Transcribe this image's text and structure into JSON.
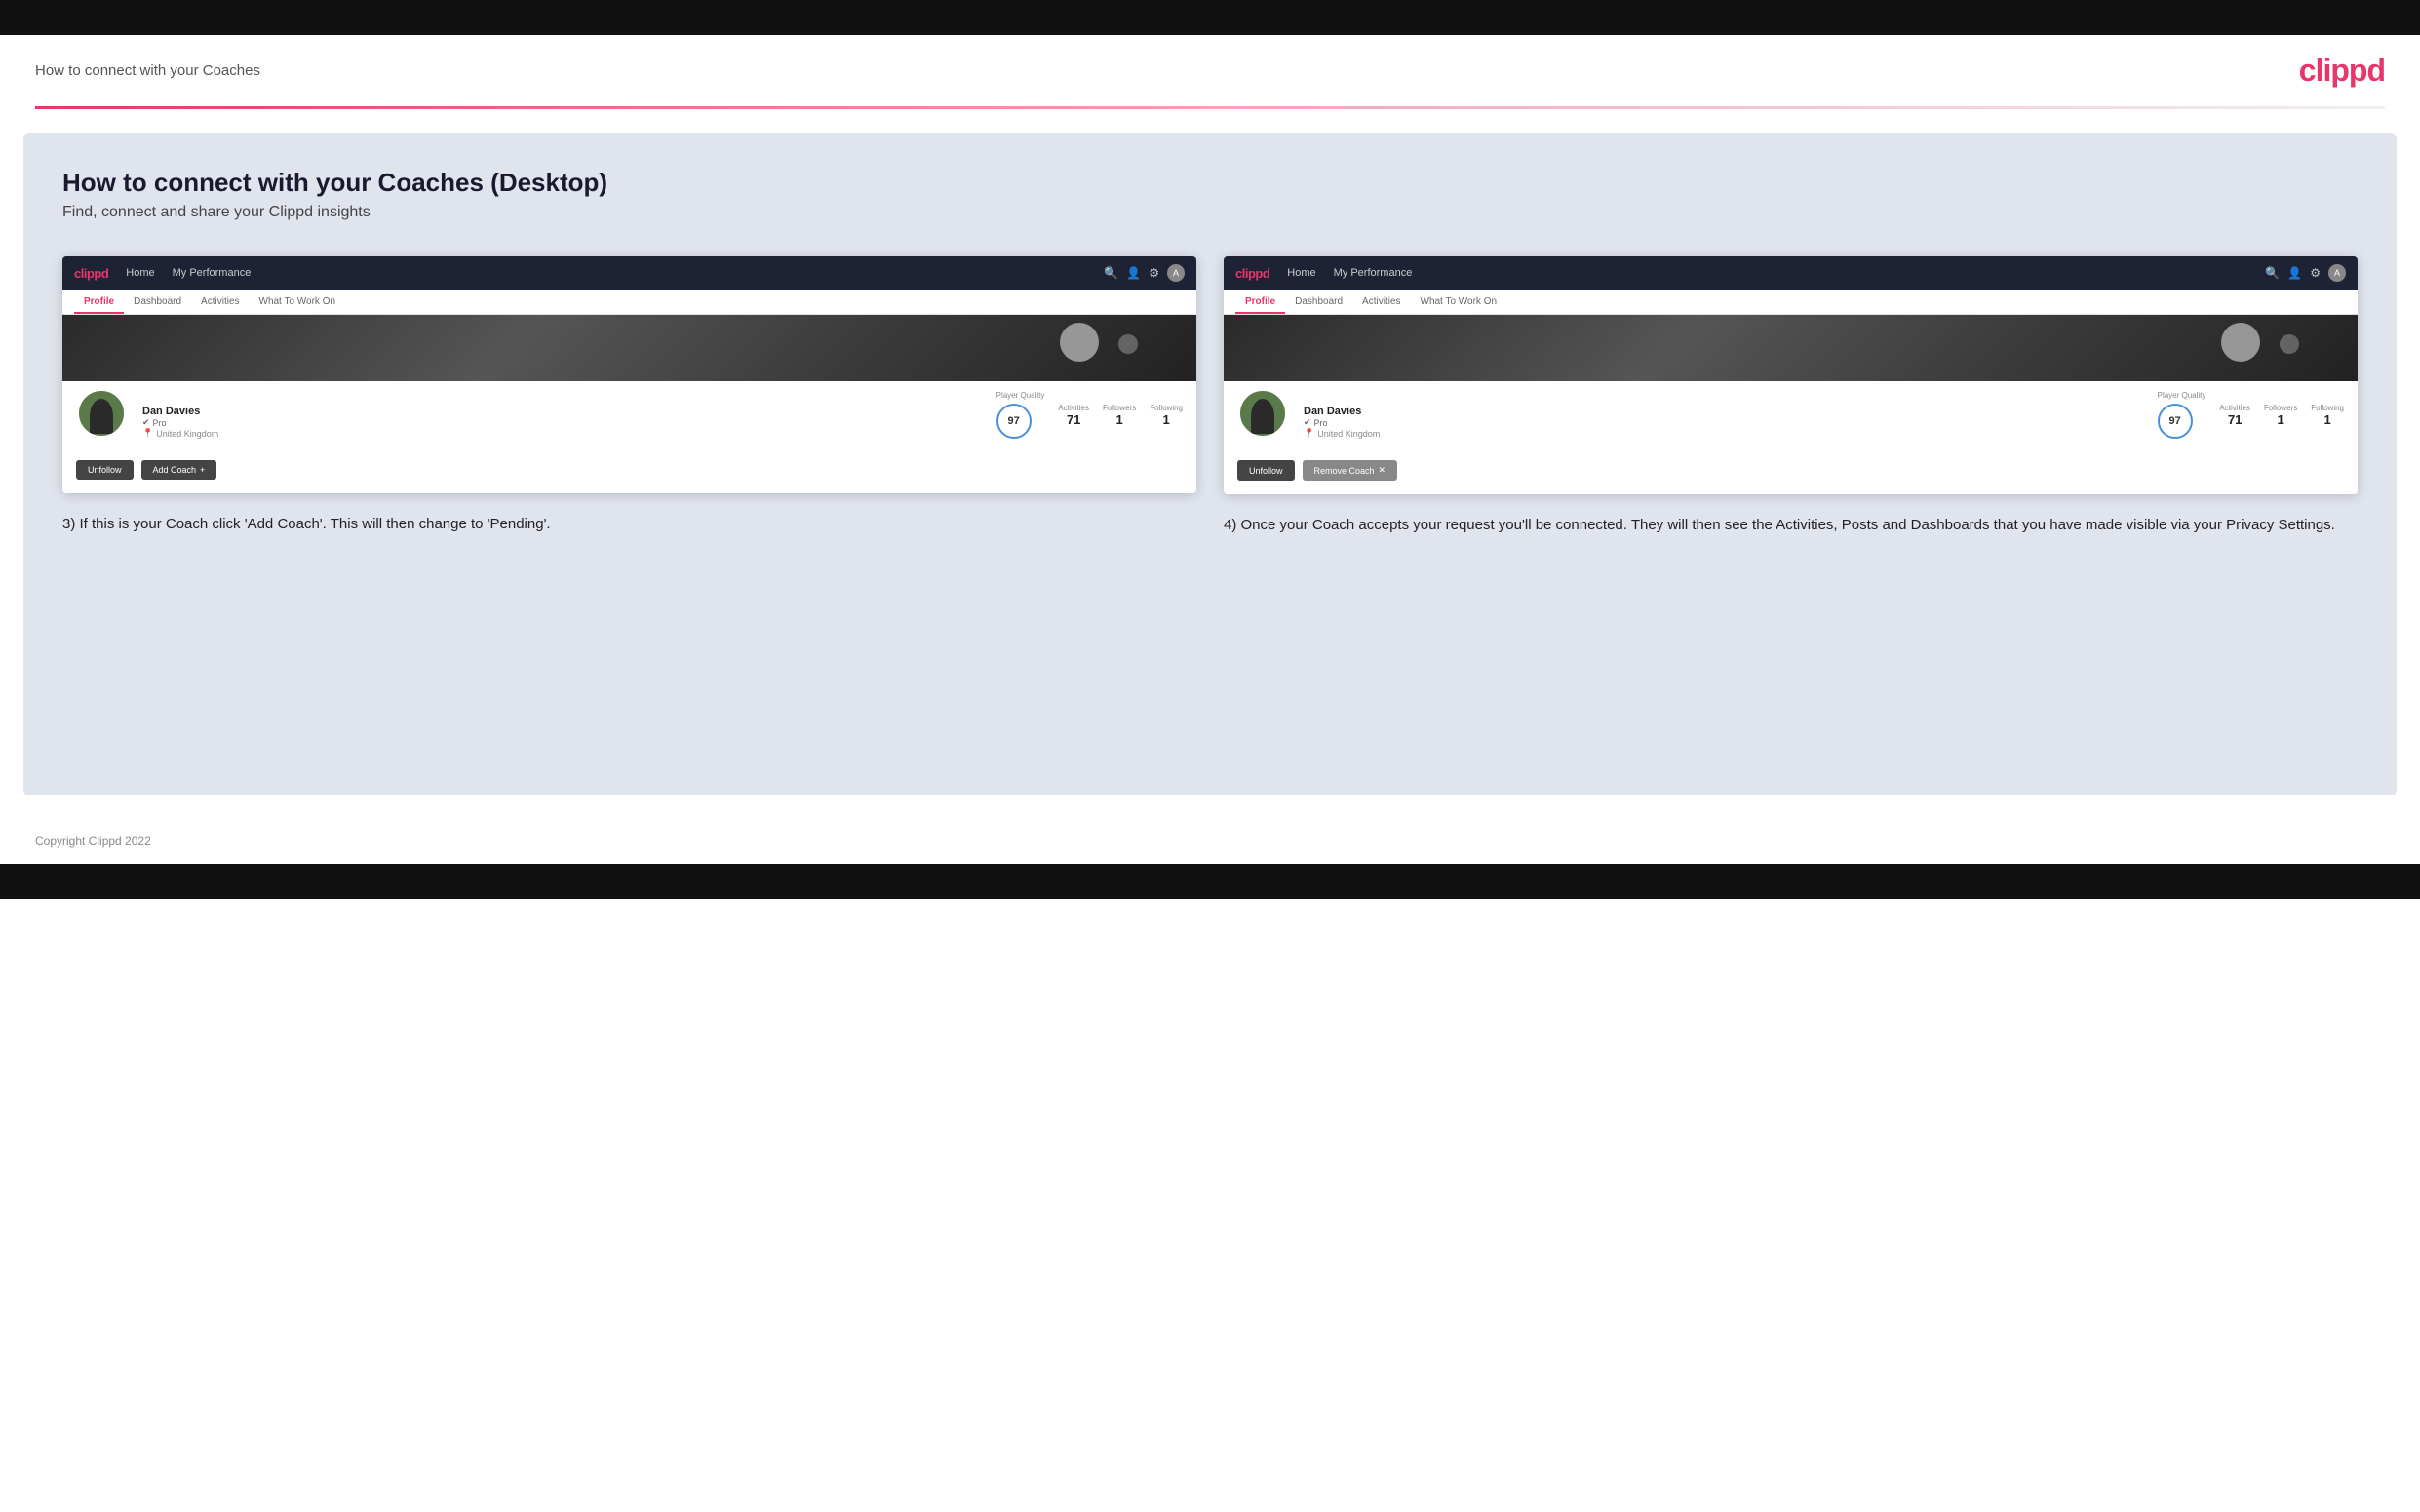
{
  "top_bar": {},
  "header": {
    "title": "How to connect with your Coaches",
    "logo": "clippd"
  },
  "main": {
    "title": "How to connect with your Coaches (Desktop)",
    "subtitle": "Find, connect and share your Clippd insights",
    "step3": {
      "description": "3) If this is your Coach click 'Add Coach'. This will then change to 'Pending'."
    },
    "step4": {
      "description": "4) Once your Coach accepts your request you'll be connected. They will then see the Activities, Posts and Dashboards that you have made visible via your Privacy Settings."
    }
  },
  "screen1": {
    "nav": {
      "logo": "clippd",
      "items": [
        "Home",
        "My Performance"
      ],
      "icons": [
        "search",
        "user",
        "settings",
        "avatar"
      ]
    },
    "tabs": [
      {
        "label": "Profile",
        "active": true
      },
      {
        "label": "Dashboard",
        "active": false
      },
      {
        "label": "Activities",
        "active": false
      },
      {
        "label": "What To Work On",
        "active": false
      }
    ],
    "user": {
      "name": "Dan Davies",
      "role": "Pro",
      "location": "United Kingdom"
    },
    "stats": {
      "player_quality_label": "Player Quality",
      "player_quality_value": "97",
      "activities_label": "Activities",
      "activities_value": "71",
      "followers_label": "Followers",
      "followers_value": "1",
      "following_label": "Following",
      "following_value": "1"
    },
    "buttons": {
      "unfollow": "Unfollow",
      "add_coach": "Add Coach"
    }
  },
  "screen2": {
    "nav": {
      "logo": "clippd",
      "items": [
        "Home",
        "My Performance"
      ],
      "icons": [
        "search",
        "user",
        "settings",
        "avatar"
      ]
    },
    "tabs": [
      {
        "label": "Profile",
        "active": true
      },
      {
        "label": "Dashboard",
        "active": false
      },
      {
        "label": "Activities",
        "active": false
      },
      {
        "label": "What To Work On",
        "active": false
      }
    ],
    "user": {
      "name": "Dan Davies",
      "role": "Pro",
      "location": "United Kingdom"
    },
    "stats": {
      "player_quality_label": "Player Quality",
      "player_quality_value": "97",
      "activities_label": "Activities",
      "activities_value": "71",
      "followers_label": "Followers",
      "followers_value": "1",
      "following_label": "Following",
      "following_value": "1"
    },
    "buttons": {
      "unfollow": "Unfollow",
      "remove_coach": "Remove Coach"
    }
  },
  "footer": {
    "copyright": "Copyright Clippd 2022"
  }
}
